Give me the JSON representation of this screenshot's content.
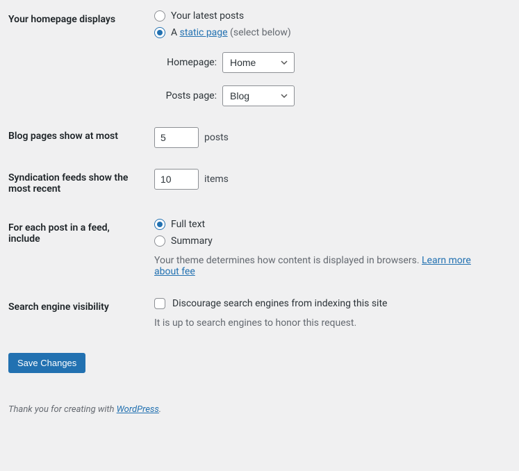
{
  "homepage": {
    "label": "Your homepage displays",
    "option_latest": "Your latest posts",
    "option_static_prefix": "A ",
    "option_static_link": "static page",
    "option_static_suffix": " (select below)",
    "homepage_label": "Homepage:",
    "homepage_value": "Home",
    "posts_page_label": "Posts page:",
    "posts_page_value": "Blog"
  },
  "blog_pages": {
    "label": "Blog pages show at most",
    "value": "5",
    "suffix": "posts"
  },
  "syndication": {
    "label": "Syndication feeds show the most recent",
    "value": "10",
    "suffix": "items"
  },
  "feed_include": {
    "label": "For each post in a feed, include",
    "option_full": "Full text",
    "option_summary": "Summary",
    "description_prefix": "Your theme determines how content is displayed in browsers. ",
    "description_link": "Learn more about fee"
  },
  "search_visibility": {
    "label": "Search engine visibility",
    "checkbox_label": "Discourage search engines from indexing this site",
    "description": "It is up to search engines to honor this request."
  },
  "submit": {
    "label": "Save Changes"
  },
  "footer": {
    "prefix": "Thank you for creating with ",
    "link": "WordPress",
    "suffix": "."
  }
}
